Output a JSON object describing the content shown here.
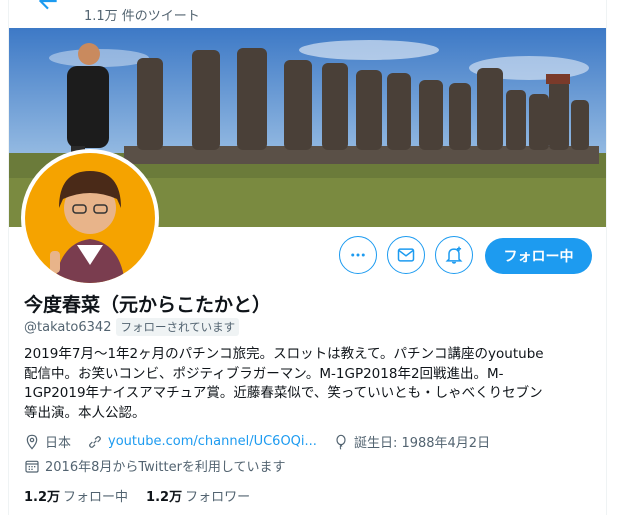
{
  "header": {
    "tweet_count": "1.1万 件のツイート",
    "back_icon": "arrow-left-icon"
  },
  "actions": {
    "more_icon": "more-dots-icon",
    "message_icon": "envelope-icon",
    "notify_icon": "bell-plus-icon",
    "follow_label": "フォロー中"
  },
  "profile": {
    "name": "今度春菜（元からこたかと）",
    "handle": "@takato6342",
    "follows_you": "フォローされています",
    "bio": "2019年7月～1年2ヶ月のパチンコ旅完。スロットは教えて。パチンコ講座のyoutube\n配信中。お笑いコンビ、ポジティブラガーマン。M-1GP2018年2回戦進出。M-\n1GP2019年ナイスアマチュア賞。近藤春菜似で、笑っていいとも・しゃべくりセブン\n等出演。本人公認。",
    "location": "日本",
    "website": "youtube.com/channel/UC6OQi...",
    "birthday": "誕生日: 1988年4月2日",
    "joined": "2016年8月からTwitterを利用しています"
  },
  "stats": {
    "following_count": "1.2万",
    "following_label": "フォロー中",
    "followers_count": "1.2万",
    "followers_label": "フォロワー"
  },
  "colors": {
    "accent": "#1d9bf0",
    "secondary_text": "#536471",
    "avatar_bg": "#f5a300"
  }
}
